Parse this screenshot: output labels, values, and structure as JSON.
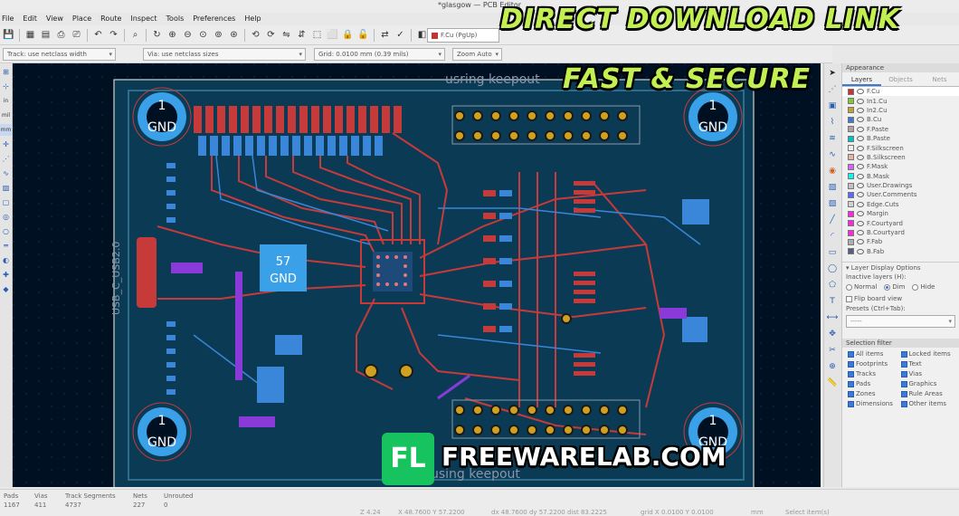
{
  "window": {
    "title": "*glasgow — PCB Editor"
  },
  "menu": [
    "File",
    "Edit",
    "View",
    "Place",
    "Route",
    "Inspect",
    "Tools",
    "Preferences",
    "Help"
  ],
  "toolbar": {
    "layer_select": "F.Cu (PgUp)"
  },
  "options": {
    "track": "Track: use netclass width",
    "via": "Via: use netclass sizes",
    "grid": "Grid: 0.0100 mm (0.39 mils)",
    "zoom": "Zoom Auto"
  },
  "left_toolbar": [
    "in",
    "mil",
    "mm"
  ],
  "board": {
    "mounting_holes": [
      {
        "num": "1",
        "net": "GND"
      },
      {
        "num": "1",
        "net": "GND"
      },
      {
        "num": "1",
        "net": "GND"
      },
      {
        "num": "1",
        "net": "GND"
      }
    ],
    "pad57": {
      "num": "57",
      "net": "GND"
    },
    "silk_top": "usring keepout",
    "silk_bottom": "using keepout",
    "connector_label": "USB_C_USB2.0"
  },
  "panel": {
    "header": "Appearance",
    "tabs": [
      "Layers",
      "Objects",
      "Nets"
    ],
    "layers": [
      {
        "name": "F.Cu",
        "color": "#c83232"
      },
      {
        "name": "In1.Cu",
        "color": "#7fc83c"
      },
      {
        "name": "In2.Cu",
        "color": "#c8a032"
      },
      {
        "name": "B.Cu",
        "color": "#3c7ad2"
      },
      {
        "name": "F.Paste",
        "color": "#b4a0a0"
      },
      {
        "name": "B.Paste",
        "color": "#00c2c2"
      },
      {
        "name": "F.Silkscreen",
        "color": "#f0f0f0"
      },
      {
        "name": "B.Silkscreen",
        "color": "#e8b2a7"
      },
      {
        "name": "F.Mask",
        "color": "#d864ff"
      },
      {
        "name": "B.Mask",
        "color": "#02ffee"
      },
      {
        "name": "User.Drawings",
        "color": "#c2c2c2"
      },
      {
        "name": "User.Comments",
        "color": "#596bff"
      },
      {
        "name": "Edge.Cuts",
        "color": "#d0d2cd"
      },
      {
        "name": "Margin",
        "color": "#ff26e2"
      },
      {
        "name": "F.Courtyard",
        "color": "#ff26e2"
      },
      {
        "name": "B.Courtyard",
        "color": "#ff26e2"
      },
      {
        "name": "F.Fab",
        "color": "#afafaf"
      },
      {
        "name": "B.Fab",
        "color": "#585d84"
      }
    ],
    "display_options_title": "Layer Display Options",
    "inactive_label": "Inactive layers (H):",
    "inactive_opts": [
      "Normal",
      "Dim",
      "Hide"
    ],
    "flip_label": "Flip board view",
    "presets_label": "Presets (Ctrl+Tab):",
    "presets_value": "-----",
    "selection_filter_title": "Selection filter",
    "filters": [
      "All items",
      "Locked items",
      "Footprints",
      "Text",
      "Tracks",
      "Vias",
      "Pads",
      "Graphics",
      "Zones",
      "Rule Areas",
      "Dimensions",
      "Other items"
    ]
  },
  "status": {
    "labels": [
      "Pads",
      "Vias",
      "Track Segments",
      "Nets",
      "Unrouted"
    ],
    "values": [
      "1167",
      "411",
      "4737",
      "227",
      "0"
    ],
    "bottom": [
      "Z 4.24",
      "X 48.7600  Y 57.2200",
      "dx 48.7600  dy 57.2200  dist 83.2225",
      "grid X 0.0100  Y 0.0100",
      "mm",
      "Select item(s)"
    ]
  },
  "promo": {
    "line1": "DIRECT DOWNLOAD LINK",
    "line2": "FAST & SECURE",
    "logo": "FL",
    "site": "FREEWARELAB.COM"
  }
}
